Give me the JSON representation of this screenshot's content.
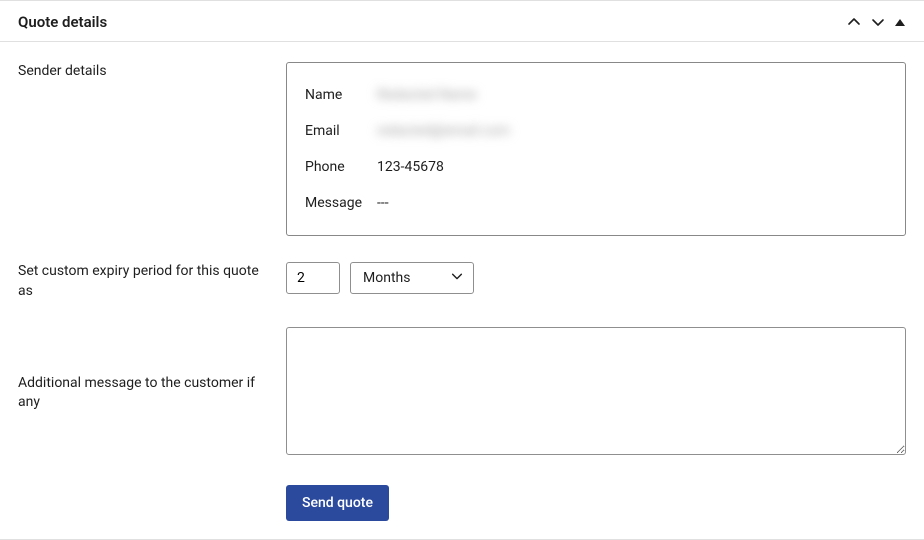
{
  "panel": {
    "title": "Quote details"
  },
  "sender": {
    "section_label": "Sender details",
    "name_label": "Name",
    "name_value": "Redacted Name",
    "email_label": "Email",
    "email_value": "redacted@email.com",
    "phone_label": "Phone",
    "phone_value": "123-45678",
    "message_label": "Message",
    "message_value": "---"
  },
  "expiry": {
    "label": "Set custom expiry period for this quote as",
    "number_value": "2",
    "unit_value": "Months"
  },
  "additional_message": {
    "label": "Additional message to the customer if any",
    "value": ""
  },
  "actions": {
    "send_label": "Send quote"
  }
}
